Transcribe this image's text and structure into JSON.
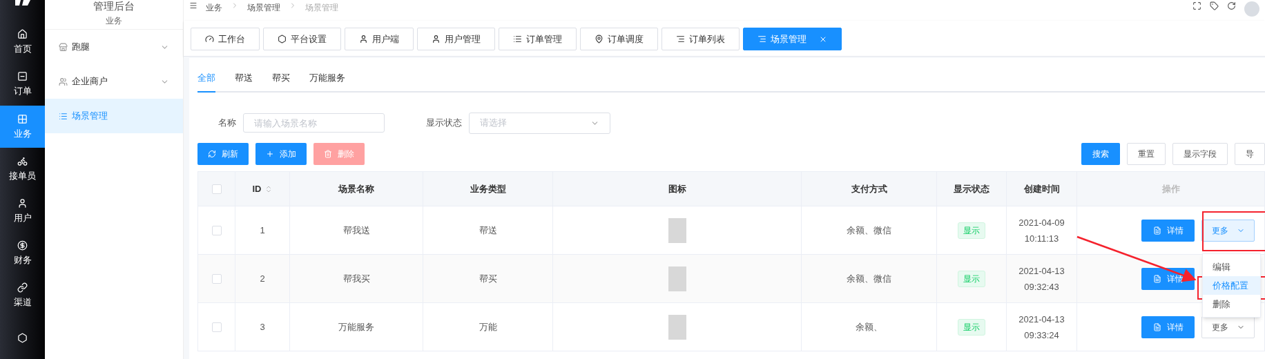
{
  "rail": {
    "items": [
      {
        "label": "首页",
        "selected": false
      },
      {
        "label": "订单",
        "selected": false
      },
      {
        "label": "业务",
        "selected": true
      },
      {
        "label": "接单员",
        "selected": false
      },
      {
        "label": "用户",
        "selected": false
      },
      {
        "label": "财务",
        "selected": false
      },
      {
        "label": "渠道",
        "selected": false
      },
      {
        "selected": false
      }
    ]
  },
  "submenu": {
    "title": "管理后台",
    "section": "业务",
    "items": [
      {
        "label": "跑腿",
        "expandable": true,
        "selected": false
      },
      {
        "label": "企业商户",
        "expandable": true,
        "selected": false
      },
      {
        "label": "场景管理",
        "expandable": false,
        "selected": true
      }
    ]
  },
  "breadcrumb": [
    "业务",
    "场景管理",
    "场景管理"
  ],
  "tabs": [
    {
      "label": "工作台",
      "selected": false
    },
    {
      "label": "平台设置",
      "selected": false
    },
    {
      "label": "用户端",
      "selected": false
    },
    {
      "label": "用户管理",
      "selected": false
    },
    {
      "label": "订单管理",
      "selected": false
    },
    {
      "label": "订单调度",
      "selected": false
    },
    {
      "label": "订单列表",
      "selected": false
    },
    {
      "label": "场景管理",
      "selected": true
    }
  ],
  "subtabs": [
    {
      "label": "全部",
      "selected": true
    },
    {
      "label": "帮送",
      "selected": false
    },
    {
      "label": "帮买",
      "selected": false
    },
    {
      "label": "万能服务",
      "selected": false
    }
  ],
  "filters": [
    {
      "label": "名称",
      "placeholder": "请输入场景名称",
      "kind": "input"
    },
    {
      "label": "显示状态",
      "placeholder": "请选择",
      "kind": "select"
    }
  ],
  "actions": [
    {
      "label": "刷新",
      "disabled": false
    },
    {
      "label": "添加",
      "disabled": false
    },
    {
      "label": "删除",
      "disabled": true
    }
  ],
  "tools": [
    {
      "label": "搜索",
      "kind": "primary"
    },
    {
      "label": "重置",
      "kind": "default"
    },
    {
      "label": "显示字段",
      "kind": "default"
    },
    {
      "label": "导",
      "kind": "default"
    }
  ],
  "table": {
    "select_all_checked": false,
    "columns": [
      {
        "label": "ID",
        "sortable": true
      },
      {
        "label": "场景名称",
        "sortable": false
      },
      {
        "label": "业务类型",
        "sortable": false
      },
      {
        "label": "图标",
        "sortable": false
      },
      {
        "label": "支付方式",
        "sortable": false
      },
      {
        "label": "显示状态",
        "sortable": false
      },
      {
        "label": "创建时间",
        "sortable": false
      },
      {
        "label": "操作",
        "sortable": false
      }
    ],
    "rows": [
      {
        "checked": false,
        "id": "1",
        "name": "帮我送",
        "type": "帮送",
        "payment": "余额、微信",
        "status": "显示",
        "date": "2021-04-09",
        "time": "10:11:13",
        "detail": "详情",
        "more": "更多",
        "more_open": true
      },
      {
        "checked": false,
        "id": "2",
        "name": "帮我买",
        "type": "帮买",
        "payment": "余额、微信",
        "status": "显示",
        "date": "2021-04-13",
        "time": "09:32:43",
        "detail": "详情"
      },
      {
        "checked": false,
        "id": "3",
        "name": "万能服务",
        "type": "万能",
        "payment": "余额、",
        "status": "显示",
        "date": "2021-04-13",
        "time": "09:33:24",
        "detail": "详情",
        "more": "更多",
        "more_open": false
      }
    ]
  },
  "menu": [
    {
      "label": "编辑",
      "selected": false
    },
    {
      "label": "价格配置",
      "selected": true
    },
    {
      "label": "删除",
      "selected": false
    }
  ]
}
